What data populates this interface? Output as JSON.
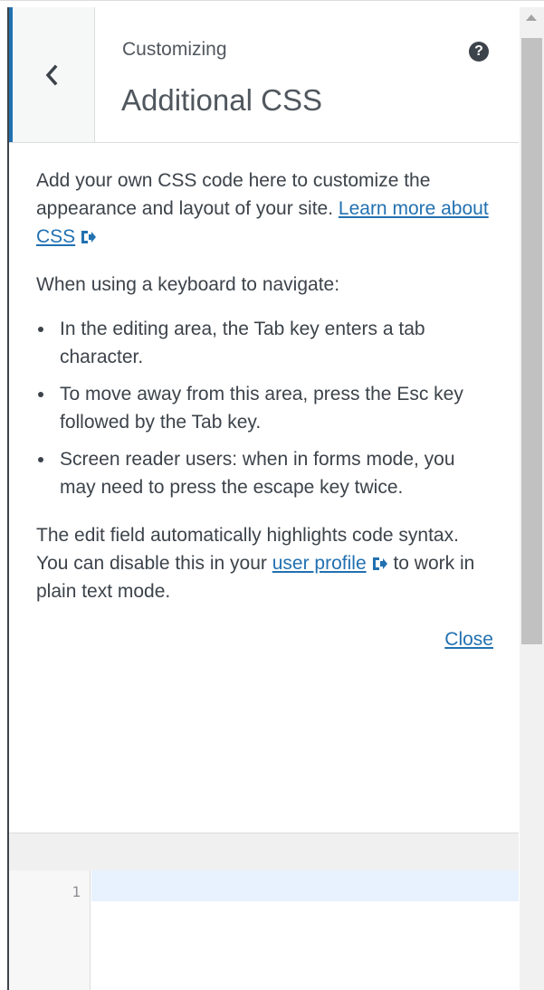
{
  "header": {
    "subtitle": "Customizing",
    "title": "Additional CSS",
    "help_label": "?"
  },
  "description": {
    "intro": "Add your own CSS code here to customize the appearance and layout of your site.",
    "learn_more_link": "Learn more about CSS",
    "keyboard_heading": "When using a keyboard to navigate:",
    "items": [
      "In the editing area, the Tab key enters a tab character.",
      "To move away from this area, press the Esc key followed by the Tab key.",
      "Screen reader users: when in forms mode, you may need to press the escape key twice."
    ],
    "syntax_before": "The edit field automatically highlights code syntax. You can disable this in your ",
    "user_profile_link": "user profile",
    "syntax_after": " to work in plain text mode.",
    "close_link": "Close"
  },
  "editor": {
    "line_numbers": [
      "1"
    ],
    "content": ""
  },
  "colors": {
    "accent": "#2271b1",
    "text": "#3c434a",
    "active_line": "#e8f2fe"
  },
  "icons": {
    "back": "chevron-left-icon",
    "help": "help-icon",
    "external": "external-link-icon"
  }
}
